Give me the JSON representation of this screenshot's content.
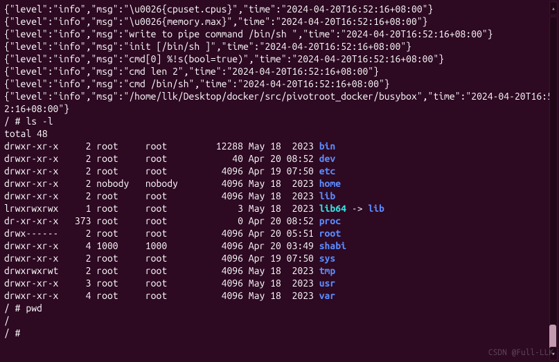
{
  "logs": [
    {
      "level": "info",
      "msg": "\\u0026{cpuset.cpus}",
      "time": "2024-04-20T16:52:16+08:00"
    },
    {
      "level": "info",
      "msg": "\\u0026{memory.max}",
      "time": "2024-04-20T16:52:16+08:00"
    },
    {
      "level": "info",
      "msg": "write to pipe command /bin/sh ",
      "time": "2024-04-20T16:52:16+08:00"
    },
    {
      "level": "info",
      "msg": "init [/bin/sh ]",
      "time": "2024-04-20T16:52:16+08:00"
    },
    {
      "level": "info",
      "msg": "cmd[0] %!s(bool=true)",
      "time": "2024-04-20T16:52:16+08:00"
    },
    {
      "level": "info",
      "msg": "cmd len 2",
      "time": "2024-04-20T16:52:16+08:00"
    },
    {
      "level": "info",
      "msg": "cmd /bin/sh",
      "time": "2024-04-20T16:52:16+08:00"
    },
    {
      "level": "info",
      "msg": "/home/llk/Desktop/docker/src/pivotroot_docker/busybox",
      "time": "2024-04-20T16:52:16+08:00"
    }
  ],
  "prompts": {
    "ls": "/ # ls -l",
    "pwd": "/ # pwd",
    "pwd_out": "/",
    "last": "/ # "
  },
  "total_line": "total 48",
  "ls": [
    {
      "perm": "drwxr-xr-x",
      "n": "2",
      "own": "root",
      "grp": "root",
      "size": "12288",
      "date": "May 18  2023",
      "name": "bin",
      "cls": "blue"
    },
    {
      "perm": "drwxr-xr-x",
      "n": "2",
      "own": "root",
      "grp": "root",
      "size": "40",
      "date": "Apr 20 08:52",
      "name": "dev",
      "cls": "blue"
    },
    {
      "perm": "drwxr-xr-x",
      "n": "2",
      "own": "root",
      "grp": "root",
      "size": "4096",
      "date": "Apr 19 07:50",
      "name": "etc",
      "cls": "blue"
    },
    {
      "perm": "drwxr-xr-x",
      "n": "2",
      "own": "nobody",
      "grp": "nobody",
      "size": "4096",
      "date": "May 18  2023",
      "name": "home",
      "cls": "blue"
    },
    {
      "perm": "drwxr-xr-x",
      "n": "2",
      "own": "root",
      "grp": "root",
      "size": "4096",
      "date": "May 18  2023",
      "name": "lib",
      "cls": "blue"
    },
    {
      "perm": "lrwxrwxrwx",
      "n": "1",
      "own": "root",
      "grp": "root",
      "size": "3",
      "date": "May 18  2023",
      "name": "lib64",
      "cls": "cyan",
      "link": "lib"
    },
    {
      "perm": "dr-xr-xr-x",
      "n": "373",
      "own": "root",
      "grp": "root",
      "size": "0",
      "date": "Apr 20 08:52",
      "name": "proc",
      "cls": "blue"
    },
    {
      "perm": "drwx------",
      "n": "2",
      "own": "root",
      "grp": "root",
      "size": "4096",
      "date": "Apr 20 05:51",
      "name": "root",
      "cls": "blue"
    },
    {
      "perm": "drwxr-xr-x",
      "n": "4",
      "own": "1000",
      "grp": "1000",
      "size": "4096",
      "date": "Apr 20 03:49",
      "name": "shabi",
      "cls": "shabi"
    },
    {
      "perm": "drwxr-xr-x",
      "n": "2",
      "own": "root",
      "grp": "root",
      "size": "4096",
      "date": "Apr 19 07:50",
      "name": "sys",
      "cls": "blue"
    },
    {
      "perm": "drwxrwxrwt",
      "n": "2",
      "own": "root",
      "grp": "root",
      "size": "4096",
      "date": "May 18  2023",
      "name": "tmp",
      "cls": "blue"
    },
    {
      "perm": "drwxr-xr-x",
      "n": "3",
      "own": "root",
      "grp": "root",
      "size": "4096",
      "date": "May 18  2023",
      "name": "usr",
      "cls": "blue"
    },
    {
      "perm": "drwxr-xr-x",
      "n": "4",
      "own": "root",
      "grp": "root",
      "size": "4096",
      "date": "May 18  2023",
      "name": "var",
      "cls": "blue"
    }
  ],
  "arrow": " -> ",
  "watermark": "CSDN @Full-LLK"
}
